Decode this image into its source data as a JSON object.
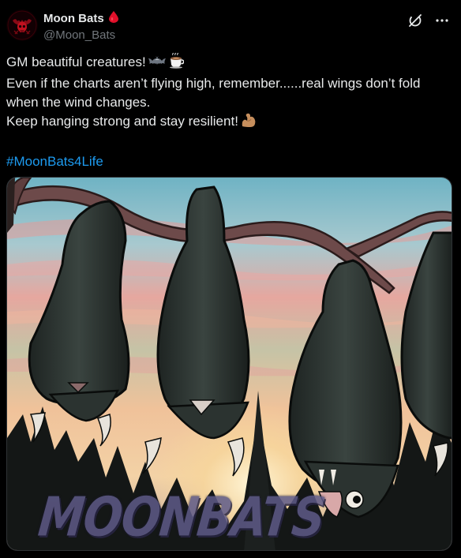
{
  "author": {
    "display_name": "Moon Bats",
    "handle": "@Moon_Bats",
    "name_emoji": "blood-drop-icon",
    "avatar_icon": "skull-emblem-icon"
  },
  "actions": {
    "grok_icon": "grok-icon",
    "more_icon": "more-options-icon"
  },
  "post": {
    "line1": "GM beautiful creatures!",
    "line1_emojis": [
      "bat-emoji",
      "coffee-emoji"
    ],
    "line2": "Even if the charts aren’t flying high, remember......real wings don’t fold",
    "line3": "when the wind changes.",
    "line4": "Keep hanging strong and stay resilient!",
    "line4_emoji": "flexed-biceps-emoji",
    "hashtag": "#MoonBats4Life"
  },
  "media": {
    "description_icon": "hanging-bats-illustration",
    "watermark": "MOONBATS"
  },
  "colors": {
    "background": "#000000",
    "text": "#e7e9ea",
    "muted": "#71767b",
    "link": "#1d9bf0",
    "accent_red": "#e0102a"
  }
}
